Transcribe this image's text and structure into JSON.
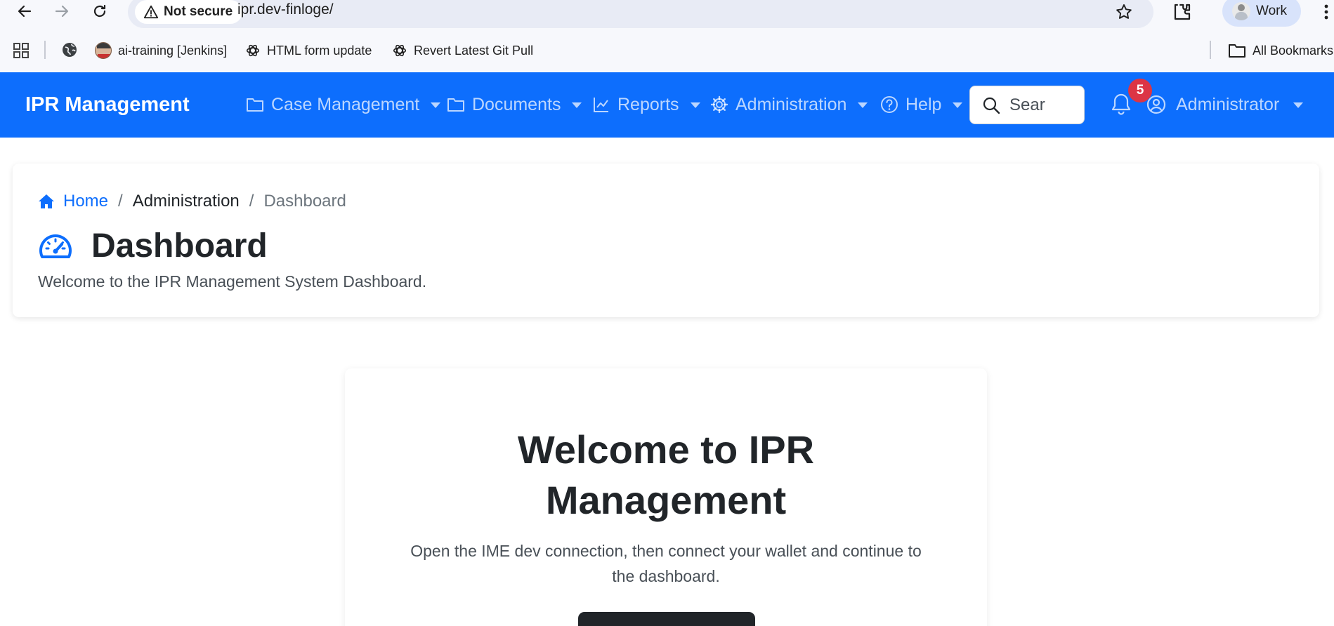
{
  "browser": {
    "security_label": "Not secure",
    "url": "ipr.dev-finloge/",
    "profile_label": "Work",
    "bookmarks": [
      {
        "label": "ai-training [Jenkins]",
        "icon": "jenkins-icon"
      },
      {
        "label": "HTML form update",
        "icon": "openai-icon"
      },
      {
        "label": "Revert Latest Git Pull",
        "icon": "openai-icon"
      }
    ],
    "all_bookmarks_label": "All Bookmarks"
  },
  "navbar": {
    "brand": "IPR Management",
    "items": [
      {
        "label": "Case Management",
        "icon": "folder-icon"
      },
      {
        "label": "Documents",
        "icon": "folder-icon"
      },
      {
        "label": "Reports",
        "icon": "chart-line-icon"
      },
      {
        "label": "Administration",
        "icon": "gear-icon"
      },
      {
        "label": "Help",
        "icon": "question-circle-icon"
      }
    ],
    "search_placeholder": "Sear",
    "notification_count": "5",
    "user_label": "Administrator",
    "color": "#0d6efd"
  },
  "breadcrumb": {
    "home": "Home",
    "separator": "/",
    "section": "Administration",
    "current": "Dashboard"
  },
  "page": {
    "title": "Dashboard",
    "subtitle": "Welcome to the IPR Management System Dashboard."
  },
  "welcome": {
    "title_line1": "Welcome to IPR",
    "title_line2": "Management",
    "text_line1": "Open the IME dev connection, then connect your wallet and continue to",
    "text_line2": "the dashboard."
  }
}
